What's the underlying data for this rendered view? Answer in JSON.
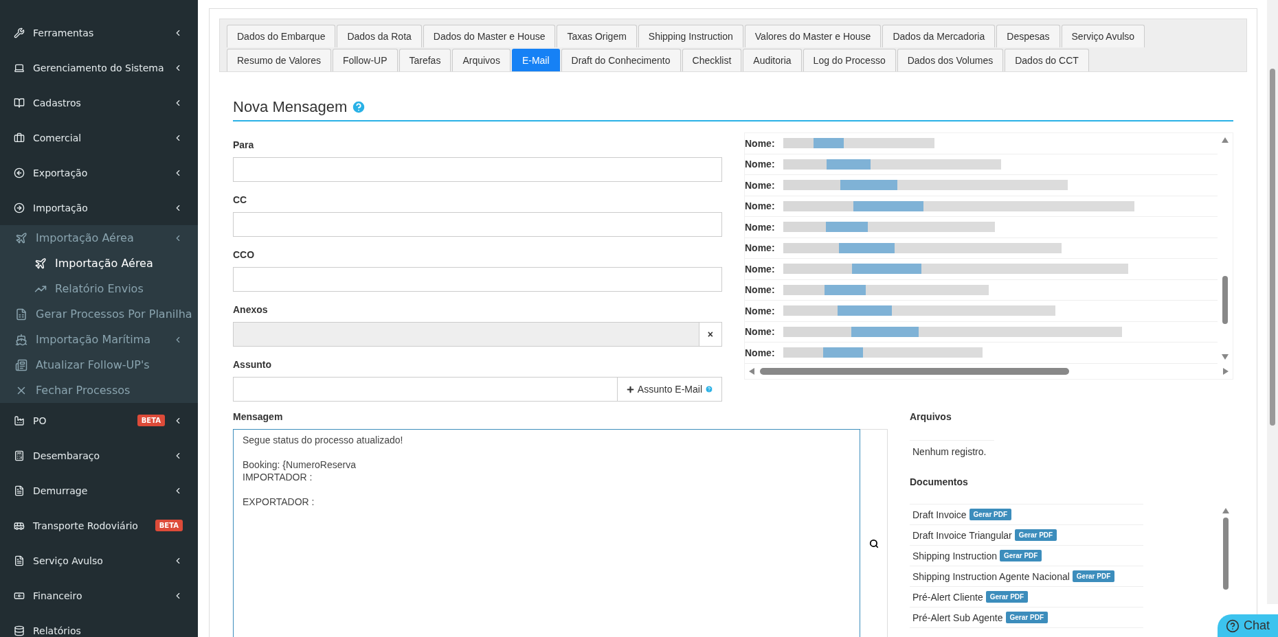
{
  "sidebar": {
    "items": [
      {
        "label": "Ferramentas",
        "has_submenu": true
      },
      {
        "label": "Gerenciamento do Sistema",
        "has_submenu": true
      },
      {
        "label": "Cadastros",
        "has_submenu": true
      },
      {
        "label": "Comercial",
        "has_submenu": true
      },
      {
        "label": "Exportação",
        "has_submenu": true
      },
      {
        "label": "Importação",
        "has_submenu": true,
        "expanded": true,
        "children": [
          {
            "label": "Importação Aérea",
            "has_submenu": true,
            "expanded": true,
            "selected": false,
            "children": [
              {
                "label": "Importação Aérea",
                "selected": true
              },
              {
                "label": "Relatório Envios",
                "selected": false
              }
            ]
          },
          {
            "label": "Gerar Processos Por Planilha",
            "selected": false
          },
          {
            "label": "Importação Marítima",
            "has_submenu": true,
            "selected": false
          },
          {
            "label": "Atualizar Follow-UP's",
            "selected": false
          },
          {
            "label": "Fechar Processos",
            "selected": false
          }
        ]
      },
      {
        "label": "PO",
        "badge": "BETA",
        "has_submenu": true
      },
      {
        "label": "Desembaraço",
        "has_submenu": true
      },
      {
        "label": "Demurrage",
        "has_submenu": true
      },
      {
        "label": "Transporte Rodoviário",
        "badge": "BETA"
      },
      {
        "label": "Serviço Avulso",
        "has_submenu": true
      },
      {
        "label": "Financeiro",
        "has_submenu": true
      },
      {
        "label": "Relatórios"
      }
    ]
  },
  "tabs": [
    [
      {
        "label": "Dados do Embarque",
        "selected": false
      },
      {
        "label": "Dados da Rota",
        "selected": false
      },
      {
        "label": "Dados do Master e House",
        "selected": false
      },
      {
        "label": "Taxas Origem",
        "selected": false
      },
      {
        "label": "Shipping Instruction",
        "selected": false
      },
      {
        "label": "Valores do Master e House",
        "selected": false
      },
      {
        "label": "Dados da Mercadoria",
        "selected": false
      },
      {
        "label": "Despesas",
        "selected": false
      },
      {
        "label": "Serviço Avulso",
        "selected": false
      }
    ],
    [
      {
        "label": "Resumo de Valores",
        "selected": false
      },
      {
        "label": "Follow-UP",
        "selected": false
      },
      {
        "label": "Tarefas",
        "selected": false
      },
      {
        "label": "Arquivos",
        "selected": false
      },
      {
        "label": "E-Mail",
        "selected": true
      },
      {
        "label": "Draft do Conhecimento",
        "selected": false
      },
      {
        "label": "Checklist",
        "selected": false
      },
      {
        "label": "Auditoria",
        "selected": false
      },
      {
        "label": "Log do Processo",
        "selected": false
      },
      {
        "label": "Dados dos Volumes",
        "selected": false
      },
      {
        "label": "Dados do CCT",
        "selected": false
      }
    ]
  ],
  "heading": "Nova Mensagem",
  "fields": [
    {
      "label": "Para",
      "kind": "text"
    },
    {
      "label": "CC",
      "kind": "text"
    },
    {
      "label": "CCO",
      "kind": "text"
    },
    {
      "label": "Anexos",
      "kind": "file",
      "disabled": true,
      "button": "×"
    },
    {
      "label": "Assunto",
      "kind": "addon",
      "button": "Assunto E-Mail"
    }
  ],
  "contacts": [
    {
      "label": "Nome:"
    },
    {
      "label": "Nome:"
    },
    {
      "label": "Nome:"
    },
    {
      "label": "Nome:"
    },
    {
      "label": "Nome:"
    },
    {
      "label": "Nome:"
    },
    {
      "label": "Nome:"
    },
    {
      "label": "Nome:"
    },
    {
      "label": "Nome:"
    },
    {
      "label": "Nome:"
    },
    {
      "label": "Nome:"
    }
  ],
  "message": {
    "label": "Mensagem",
    "value": "Segue status do processo atualizado!\n\nBooking: {NumeroReserva\nIMPORTADOR :\n\nEXPORTADOR :"
  },
  "files": {
    "title": "Arquivos",
    "empty": "Nenhum registro."
  },
  "documents": {
    "title": "Documentos",
    "items": [
      {
        "label": "Draft Invoice",
        "button": "Gerar PDF"
      },
      {
        "label": "Draft Invoice Triangular",
        "button": "Gerar PDF"
      },
      {
        "label": "Shipping Instruction",
        "button": "Gerar PDF"
      },
      {
        "label": "Shipping Instruction Agente Nacional",
        "button": "Gerar PDF"
      },
      {
        "label": "Pré-Alert Cliente",
        "button": "Gerar PDF"
      },
      {
        "label": "Pré-Alert Sub Agente",
        "button": "Gerar PDF"
      }
    ]
  },
  "chat": "Chat"
}
